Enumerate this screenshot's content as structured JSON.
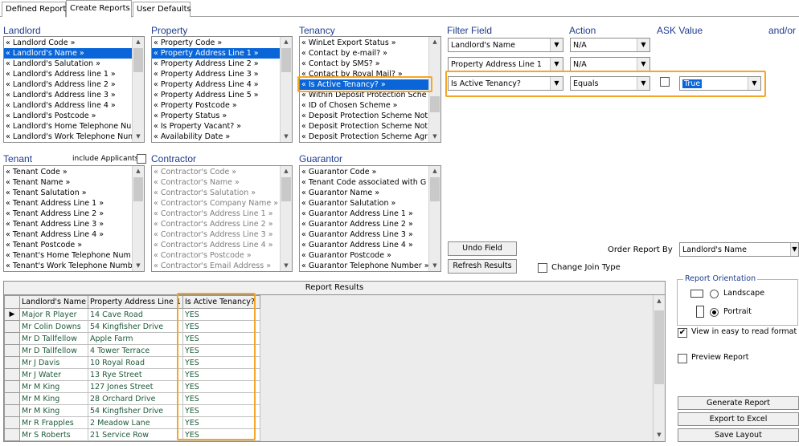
{
  "tabs": [
    "Defined Reports",
    "Create Reports",
    "User Defaults"
  ],
  "sections": {
    "landlord": "Landlord",
    "property": "Property",
    "tenancy": "Tenancy",
    "tenant": "Tenant",
    "include_applicants": "include Applicants",
    "contractor": "Contractor",
    "guarantor": "Guarantor"
  },
  "filter_headers": {
    "filter_field": "Filter Field",
    "action": "Action",
    "ask_value": "ASK Value",
    "and_or": "and/or"
  },
  "landlord_list": {
    "items": [
      "« Landlord Code »",
      "« Landlord's Name »",
      "« Landlord's Salutation »",
      "« Landlord's Address line 1 »",
      "« Landlord's Address line 2 »",
      "« Landlord's Address line 3 »",
      "« Landlord's Address line 4 »",
      "« Landlord's Postcode »",
      "« Landlord's Home Telephone Nu",
      "« Landlord's Work Telephone Num"
    ],
    "selected_index": 1
  },
  "property_list": {
    "items": [
      "« Property Code »",
      "« Property Address Line 1 »",
      "« Property Address Line 2 »",
      "« Property Address Line 3 »",
      "« Property Address Line 4 »",
      "« Property Address Line 5 »",
      "« Property Postcode »",
      "« Property Status »",
      "« Is Property Vacant? »",
      "« Availability Date »"
    ],
    "selected_index": 1
  },
  "tenancy_list": {
    "items": [
      "« WinLet Export Status »",
      "« Contact by e-mail? »",
      "« Contact by SMS? »",
      "« Contact by Royal Mail? »",
      "« Is Active Tenancy? »",
      "« Within Deposit Protection Sche",
      "« ID of Chosen Scheme »",
      "« Deposit Protection Scheme Not",
      "« Deposit Protection Scheme Not",
      "« Deposit Protection Scheme Agr"
    ],
    "selected_index": 4
  },
  "tenant_list": {
    "items": [
      "« Tenant Code »",
      "« Tenant Name »",
      "« Tenant Salutation »",
      "« Tenant Address Line 1 »",
      "« Tenant Address Line 2 »",
      "« Tenant Address Line 3 »",
      "« Tenant Address Line 4 »",
      "« Tenant Postcode »",
      "« Tenant's Home Telephone Num",
      "« Tenant's Work Telephone Numb"
    ]
  },
  "contractor_list": {
    "items": [
      "« Contractor's Code »",
      "« Contractor's Name »",
      "« Contractor's Salutation »",
      "« Contractor's Company Name »",
      "« Contractor's Address Line 1 »",
      "« Contractor's Address Line 2 »",
      "« Contractor's Address Line 3 »",
      "« Contractor's Address Line 4 »",
      "« Contractor's Postcode »",
      "« Contractor's Email Address »"
    ]
  },
  "guarantor_list": {
    "items": [
      "« Guarantor Code »",
      "« Tenant Code associated with G",
      "« Guarantor Name »",
      "« Guarantor Salutation »",
      "« Guarantor Address Line 1 »",
      "« Guarantor Address Line 2 »",
      "« Guarantor Address Line 3 »",
      "« Guarantor Address Line 4 »",
      "« Guarantor Postcode »",
      "« Guarantor Telephone Number »"
    ]
  },
  "filters": [
    {
      "field": "Landlord's Name",
      "action": "N/A"
    },
    {
      "field": "Property Address Line 1",
      "action": "N/A"
    },
    {
      "field": "Is Active Tenancy?",
      "action": "Equals",
      "ask": false,
      "value": "True"
    }
  ],
  "buttons": {
    "undo_field": "Undo Field",
    "refresh_results": "Refresh Results",
    "generate_report": "Generate Report",
    "export_excel": "Export to Excel",
    "save_layout": "Save Layout"
  },
  "change_join_type": "Change Join Type",
  "order_by": {
    "label": "Order Report By",
    "value": "Landlord's Name"
  },
  "orientation": {
    "title": "Report Orientation",
    "landscape": "Landscape",
    "portrait": "Portrait",
    "selected": "Portrait"
  },
  "view_easy": {
    "label": "View in easy to read format",
    "checked": true
  },
  "preview": {
    "label": "Preview Report",
    "checked": false
  },
  "results": {
    "caption": "Report Results",
    "columns": [
      "Landlord's Name",
      "Property Address Line 1",
      "Is Active Tenancy?"
    ],
    "rows": [
      [
        "Major R Player",
        "14 Cave Road",
        "YES"
      ],
      [
        "Mr Colin Downs",
        "54 Kingfisher Drive",
        "YES"
      ],
      [
        "Mr D Tallfellow",
        "Apple Farm",
        "YES"
      ],
      [
        "Mr D Tallfellow",
        "4 Tower Terrace",
        "YES"
      ],
      [
        "Mr J Davis",
        "10 Royal Road",
        "YES"
      ],
      [
        "Mr J Water",
        "13 Rye Street",
        "YES"
      ],
      [
        "Mr M King",
        "127 Jones Street",
        "YES"
      ],
      [
        "Mr M King",
        "28 Orchard Drive",
        "YES"
      ],
      [
        "Mr M King",
        "54 Kingfisher Drive",
        "YES"
      ],
      [
        "Mr R Frapples",
        "2 Meadow Lane",
        "YES"
      ],
      [
        "Mr S Roberts",
        "21 Service Row",
        "YES"
      ]
    ]
  },
  "colors": {
    "selection": "#0a66d8",
    "highlight": "#f5a623",
    "header_text": "#1f3c90",
    "cell_text": "#1e5b3a"
  }
}
